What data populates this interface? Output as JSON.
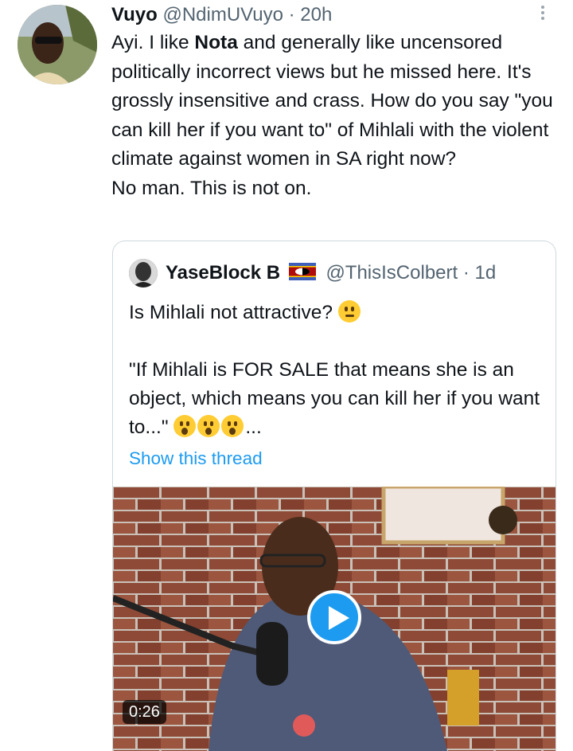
{
  "tweet": {
    "display_name": "Vuyo",
    "handle_time": " @NdimUVuyo · 20h",
    "text_before_bold": "Ayi. I like ",
    "bold_word": "Nota",
    "text_after_bold": " and generally like uncensored politically incorrect views but he missed here. It's grossly insensitive and crass. How do you say \"you can kill her if you want to\" of Mihlali with the violent climate against women in SA right now?\nNo man. This is not on."
  },
  "quoted_tweet": {
    "display_name": "YaseBlock B",
    "flag_icon": "eswatini-flag-icon",
    "handle_time": "@ThisIsColbert · 1d",
    "line1": "Is Mihlali not attractive?",
    "line2": "\"If Mihlali is FOR SALE that means she is an object, which means you can kill her if you want to...\"",
    "ellipsis": "...",
    "show_thread": "Show this thread",
    "video_duration": "0:26"
  },
  "colors": {
    "link": "#1d9bf0",
    "secondary_text": "#536471",
    "border": "#cfd9de"
  }
}
